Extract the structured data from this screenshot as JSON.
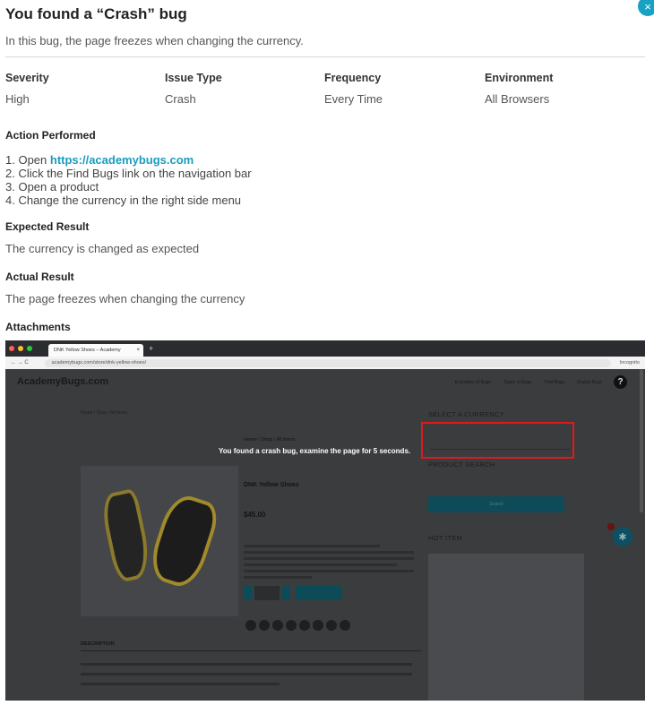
{
  "bug": {
    "title": "You found a “Crash” bug",
    "subtitle": "In this bug, the page freezes when changing the currency.",
    "fields": [
      {
        "label": "Severity",
        "value": "High"
      },
      {
        "label": "Issue Type",
        "value": "Crash"
      },
      {
        "label": "Frequency",
        "value": "Every Time"
      },
      {
        "label": "Environment",
        "value": "All Browsers"
      }
    ],
    "action_title": "Action Performed",
    "steps": [
      {
        "prefix": "1. Open ",
        "link": "https://academybugs.com"
      },
      {
        "text": "2. Click the Find Bugs link on the navigation bar"
      },
      {
        "text": "3. Open a product"
      },
      {
        "text": "4. Change the currency in the right side menu"
      }
    ],
    "expected_title": "Expected Result",
    "expected_text": "The currency is changed as expected",
    "actual_title": "Actual Result",
    "actual_text": "The page freezes when changing the currency",
    "attachments_title": "Attachments"
  },
  "close_icon": "close-icon",
  "close_glyph": "×",
  "accent_color": "#1a9bbf",
  "screenshot": {
    "tab_title": "DNK Yellow Shoes – Academy",
    "tab_close": "×",
    "new_tab": "+",
    "url": "academybugs.com/store/dnk-yellow-shoes/",
    "incognito": "Incognito",
    "site_logo": "AcademyBugs.com",
    "nav": [
      "Examples of Bugs",
      "Types of Bugs",
      "Find Bugs",
      "Report Bugs"
    ],
    "help": "?",
    "breadcrumb": "Home / Shop / All Items",
    "product_breadcrumb": "Home / Shop / All Items",
    "product_name": "DNK Yellow Shoes",
    "price": "$45.00",
    "description_tab": "DESCRIPTION",
    "select_currency": "SELECT A CURRENCY",
    "product_search": "PRODUCT SEARCH",
    "search_button": "Search",
    "hot_item": "HOT ITEM",
    "overlay_message": "You found a crash bug, examine the page for 5 seconds.",
    "highlight_color": "#e01a1a"
  }
}
